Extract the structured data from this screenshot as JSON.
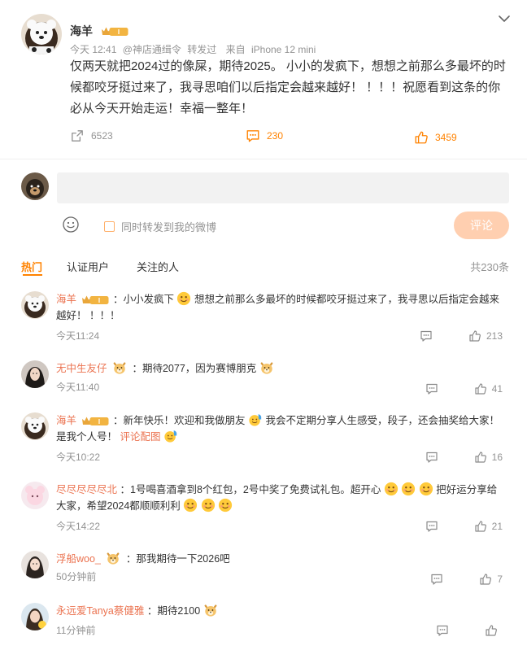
{
  "post": {
    "author": "海羊",
    "badge": "I",
    "time": "今天 12:41",
    "mention": "@神店通缉令",
    "action": "转发过",
    "source_prefix": "来自",
    "source": "iPhone 12 mini",
    "text": "仅两天就把2024过的像屎，期待2025。 小小的发疯下，想想之前那么多最坏的时候都咬牙挺过来了，我寻思咱们以后指定会越来越好！ ！！！祝愿看到这条的你必从今天开始走运！幸福一整年！",
    "reposts": "6523",
    "comments": "230",
    "likes": "3459"
  },
  "composer": {
    "placeholder": "",
    "repost_label": "同时转发到我的微博",
    "submit_label": "评论"
  },
  "tabs": {
    "hot": "热门",
    "verified": "认证用户",
    "following": "关注的人",
    "count": "共230条"
  },
  "comments": [
    {
      "name": "海羊",
      "text_a": "：小小发疯下",
      "text_b": "想想之前那么多最坏的时候都咬牙挺过来了，我寻思以后指定会越来越好！ ！！！",
      "time": "今天11:24",
      "likes": "213"
    },
    {
      "name": "无中生友仔",
      "text_a": "：期待2077，因为赛博朋克",
      "time": "今天11:40",
      "likes": "41"
    },
    {
      "name": "海羊",
      "text_a": "：新年快乐！欢迎和我做朋友",
      "text_b": "我会不定期分享人生感受，段子，还会抽奖给大家！是我个人号！",
      "link": "评论配图",
      "time": "今天10:22",
      "likes": "16"
    },
    {
      "name": "尽尽尽尽尽北",
      "text_a": "：1号喝喜酒拿到8个红包，2号中奖了免费试礼包。超开心",
      "text_b": "把好运分享给大家，希望2024都顺顺利利",
      "time": "今天14:22",
      "likes": "21"
    },
    {
      "name": "浮船woo_",
      "text_a": "：那我期待一下2026吧",
      "time": "50分钟前",
      "likes": "7"
    },
    {
      "name": "永远爱Tanya蔡健雅",
      "text_a": "：期待2100",
      "time": "11分钟前",
      "likes": ""
    }
  ],
  "icons": {
    "repost": "repost-icon",
    "comment": "comment-icon",
    "like": "like-icon",
    "emoji": "emoji-icon",
    "chevron": "chevron-down-icon"
  },
  "colors": {
    "accent": "#ff8200",
    "name": "#eb7350",
    "muted": "#939393",
    "submit_disabled": "#ffcfb0"
  }
}
